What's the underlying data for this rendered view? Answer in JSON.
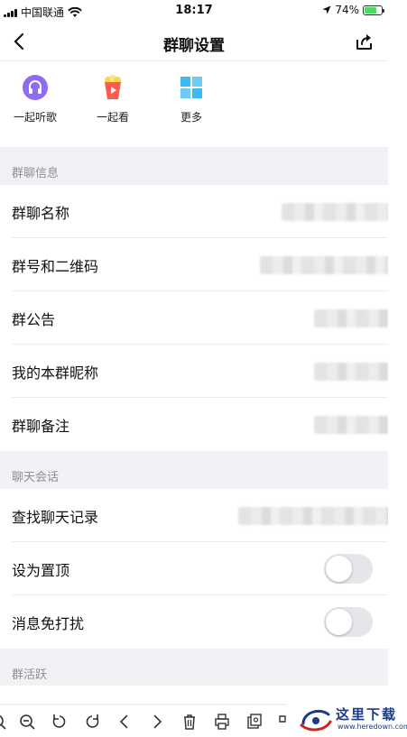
{
  "status_bar": {
    "carrier": "中国联通",
    "time": "18:17",
    "battery": "74%",
    "battery_level": 0.74
  },
  "nav": {
    "title": "群聊设置",
    "icons": {
      "back": "chevron-left-icon",
      "share": "share-out-icon"
    }
  },
  "quick_actions": [
    {
      "label": "一起听歌",
      "icon": "earphones-icon",
      "color": "#8e6bf0"
    },
    {
      "label": "一起看",
      "icon": "popcorn-icon",
      "color": "#ff5a4e"
    },
    {
      "label": "更多",
      "icon": "grid-icon",
      "color": "#3fb7f0"
    }
  ],
  "sections": {
    "group_info": {
      "header": "群聊信息",
      "rows": [
        {
          "label": "群聊名称"
        },
        {
          "label": "群号和二维码"
        },
        {
          "label": "群公告"
        },
        {
          "label": "我的本群昵称"
        },
        {
          "label": "群聊备注"
        }
      ]
    },
    "chat": {
      "header": "聊天会话",
      "rows": [
        {
          "label": "查找聊天记录"
        },
        {
          "label": "设为置顶",
          "toggle": false
        },
        {
          "label": "消息免打扰",
          "toggle": false
        }
      ]
    },
    "activity": {
      "header": "群活跃"
    }
  },
  "watermark": {
    "title": "这里下载",
    "url": "www.heredown.com"
  }
}
